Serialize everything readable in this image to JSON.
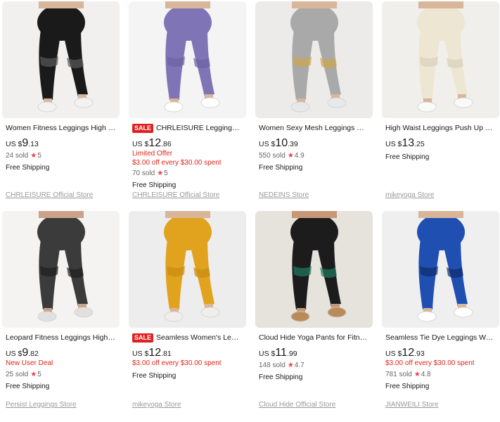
{
  "colors": {
    "accent_red": "#e1251b",
    "sale_badge": "#e02020",
    "star": "#fd384f"
  },
  "products": [
    {
      "title": "Women Fitness Leggings High Wai...",
      "price": {
        "currency": "US $",
        "int": "9",
        "dec": ".13"
      },
      "sale": "",
      "promo": [],
      "sold": "24 sold",
      "rating": "5",
      "shipping": "Free Shipping",
      "store": "CHRLEISURE Official Store",
      "image": {
        "bg": "#f2f0ee",
        "legging": "#1a1a1a",
        "accent": "#5a5a5a",
        "skin": "#d9b59a",
        "shoe": "#f2f2f2",
        "icon": "black-leggings-photo"
      }
    },
    {
      "title": "CHRLEISURE Leggings Wo...",
      "price": {
        "currency": "US $",
        "int": "12",
        "dec": ".86"
      },
      "sale": "SALE",
      "promo": [
        "Limited Offer",
        "$3.00 off every $30.00 spent"
      ],
      "sold": "70 sold",
      "rating": "5",
      "shipping": "Free Shipping",
      "store": "CHRLEISURE Official Store",
      "image": {
        "bg": "#f4f4f4",
        "legging": "#7f74b6",
        "accent": "#6c62a3",
        "skin": "#d9b59a",
        "shoe": "#ffffff",
        "icon": "purple-leggings-photo"
      }
    },
    {
      "title": "Women Sexy Mesh Leggings High ...",
      "price": {
        "currency": "US $",
        "int": "10",
        "dec": ".39"
      },
      "sale": "",
      "promo": [],
      "sold": "550 sold",
      "rating": "4.9",
      "shipping": "Free Shipping",
      "store": "NEDEINS Store",
      "image": {
        "bg": "#ecebea",
        "legging": "#a9a9a9",
        "accent": "#cfa64a",
        "skin": "#d9b59a",
        "shoe": "#e8e8e8",
        "icon": "grey-mesh-leggings-photo"
      }
    },
    {
      "title": "High Waist Leggings Push Up Spor...",
      "price": {
        "currency": "US $",
        "int": "13",
        "dec": ".25"
      },
      "sale": "",
      "promo": [],
      "sold": "",
      "rating": "",
      "shipping": "Free Shipping",
      "store": "mikeyoga Store",
      "image": {
        "bg": "#f1efeb",
        "legging": "#ede6d3",
        "accent": "#d8d0bb",
        "skin": "#d9b59a",
        "shoe": "#fafafa",
        "icon": "cream-leggings-photo"
      }
    },
    {
      "title": "Leopard Fitness Leggings High Wai...",
      "price": {
        "currency": "US $",
        "int": "9",
        "dec": ".82"
      },
      "sale": "",
      "promo": [
        "New User Deal"
      ],
      "sold": "25 sold",
      "rating": "5",
      "shipping": "Free Shipping",
      "store": "Persist Leggings Store",
      "image": {
        "bg": "#f4f3f1",
        "legging": "#3b3b3b",
        "accent": "#1f1f1f",
        "skin": "#c9a389",
        "shoe": "#e0e0e0",
        "icon": "leopard-leggings-photo"
      }
    },
    {
      "title": "Seamless Women's Leggin...",
      "price": {
        "currency": "US $",
        "int": "12",
        "dec": ".81"
      },
      "sale": "SALE",
      "promo": [
        "$3.00 off every $30.00 spent"
      ],
      "sold": "",
      "rating": "",
      "shipping": "Free Shipping",
      "store": "mikeyoga Store",
      "image": {
        "bg": "#ededed",
        "legging": "#e1a21e",
        "accent": "#c98b12",
        "skin": "#d9b59a",
        "shoe": "#f0eeea",
        "icon": "mustard-leggings-photo"
      }
    },
    {
      "title": "Cloud Hide Yoga Pants for Fitness ...",
      "price": {
        "currency": "US $",
        "int": "11",
        "dec": ".99"
      },
      "sale": "",
      "promo": [],
      "sold": "148 sold",
      "rating": "4.7",
      "shipping": "Free Shipping",
      "store": "Cloud Hide Official Store",
      "image": {
        "bg": "#e6e2dc",
        "legging": "#1c1c1c",
        "accent": "#1f7a63",
        "skin": "#c79877",
        "shoe": "#b98b5a",
        "icon": "green-black-leggings-photo"
      }
    },
    {
      "title": "Seamless Tie Dye Leggings Wome...",
      "price": {
        "currency": "US $",
        "int": "12",
        "dec": ".93"
      },
      "sale": "",
      "promo": [
        "$3.00 off every $30.00 spent"
      ],
      "sold": "781 sold",
      "rating": "4.8",
      "shipping": "Free Shipping",
      "store": "JIANWEILI Store",
      "image": {
        "bg": "#efefef",
        "legging": "#1f4fb0",
        "accent": "#0f2c6e",
        "skin": "#d9b59a",
        "shoe": "#ffffff",
        "icon": "blue-tie-dye-leggings-photo"
      }
    }
  ]
}
